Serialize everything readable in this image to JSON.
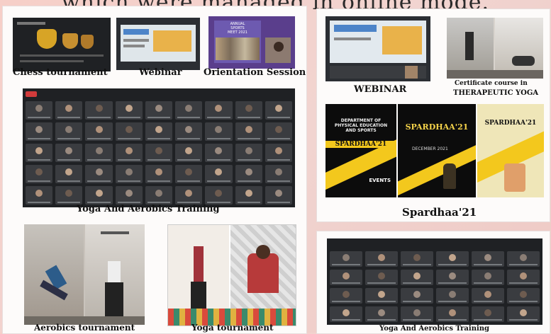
{
  "header_text": "which were managed in online mode.",
  "left_panel": {
    "captions": {
      "chess": "Chess tournament",
      "webinar": "Webinar",
      "orientation": "Orientation Session",
      "yoga_aerobics": "Yoga And Aerobics Training",
      "aerobics": "Aerobics tournament",
      "yoga": "Yoga tournament"
    },
    "orientation_banner": "ANNUAL SPORTS MEET 2021"
  },
  "right_panel": {
    "captions": {
      "webinar": "WEBINAR",
      "certificate_line1": "Certificate course in",
      "certificate_line2": "THERAPEUTIC YOGA",
      "spardhaa": "Spardhaa'21",
      "yoga_aerobics": "Yoga And Aerobics Training"
    },
    "posters": [
      {
        "title": "SPARDHAA'21",
        "subtitle": "DEPARTMENT OF PHYSICAL EDUCATION AND SPORTS",
        "note": "EVENTS"
      },
      {
        "title": "SPARDHAA'21",
        "subtitle": "DECEMBER 2021",
        "note": ""
      },
      {
        "title": "SPARDHAA'21",
        "subtitle": "",
        "note": ""
      }
    ]
  },
  "colors": {
    "background": "#f2cfca",
    "panel": "#fdfbfa",
    "meeting_dark": "#1f2124",
    "poster_yellow": "#f3c81d"
  }
}
